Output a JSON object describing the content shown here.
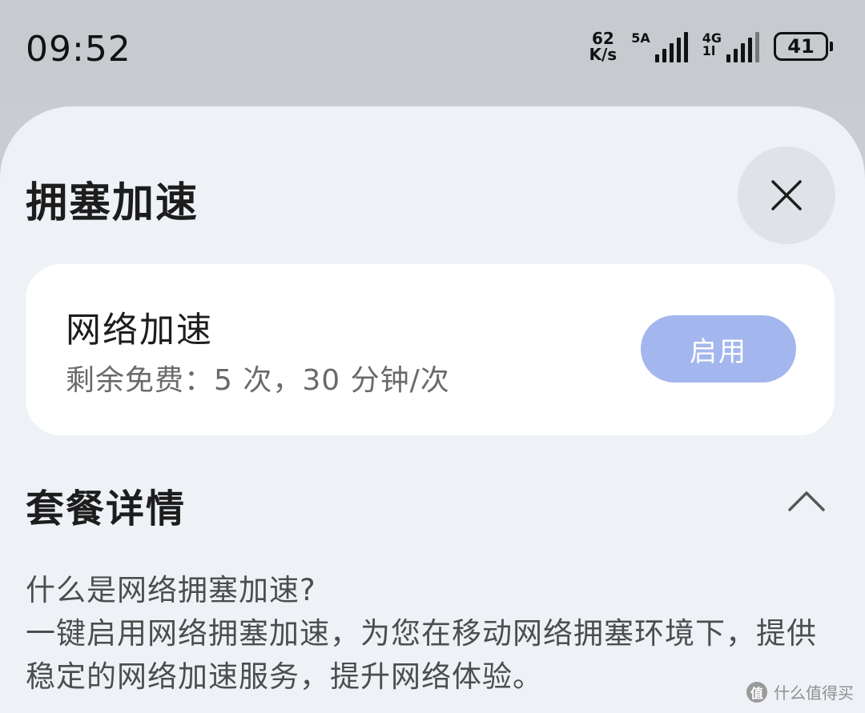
{
  "status_bar": {
    "time": "09:52",
    "net_speed_value": "62",
    "net_speed_unit": "K/s",
    "sim1_tag": "5A",
    "sim2_tag_top": "4G",
    "sim2_tag_bottom": "1l",
    "battery_level": "41"
  },
  "sheet": {
    "title": "拥塞加速"
  },
  "card": {
    "title": "网络加速",
    "subtitle": "剩余免费：5 次，30 分钟/次",
    "enable_label": "启用"
  },
  "section": {
    "title": "套餐详情"
  },
  "faq": {
    "question": "什么是网络拥塞加速?",
    "answer": "一键启用网络拥塞加速，为您在移动网络拥塞环境下，提供稳定的网络加速服务，提升网络体验。"
  },
  "watermark": {
    "logo_text": "值",
    "text": "什么值得买"
  },
  "colors": {
    "accent_button": "#a4b6ee",
    "sheet_background": "#eef2f7",
    "status_bar_background": "#c7cacf"
  },
  "icons": {
    "close": "close-icon",
    "collapse": "chevron-up-icon"
  }
}
